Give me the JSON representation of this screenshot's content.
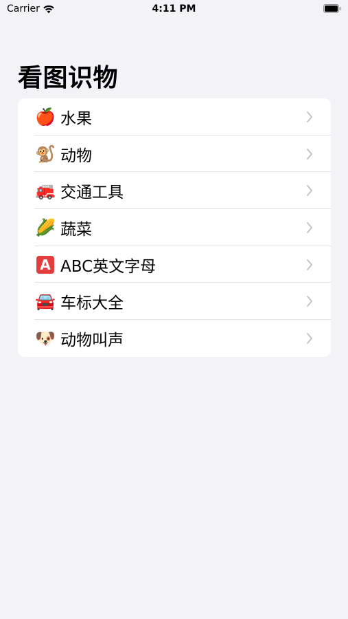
{
  "status_bar": {
    "carrier": "Carrier",
    "time": "4:11 PM"
  },
  "title": "看图识物",
  "items": [
    {
      "label": "水果",
      "emoji": "🍎",
      "icon": "apple-icon"
    },
    {
      "label": "动物",
      "emoji": "🐒",
      "icon": "monkey-icon"
    },
    {
      "label": "交通工具",
      "emoji": "🚒",
      "icon": "fire-engine-icon"
    },
    {
      "label": "蔬菜",
      "emoji": "🌽",
      "icon": "corn-icon"
    },
    {
      "label": "ABC英文字母",
      "emoji": "🅰️",
      "icon": "letter-a-icon"
    },
    {
      "label": "车标大全",
      "emoji": "🚘",
      "icon": "car-icon"
    },
    {
      "label": "动物叫声",
      "emoji": "🐶",
      "icon": "dog-icon"
    }
  ],
  "colors": {
    "background": "#f2f2f7",
    "card": "#ffffff",
    "chevron": "#c4c4c7"
  }
}
